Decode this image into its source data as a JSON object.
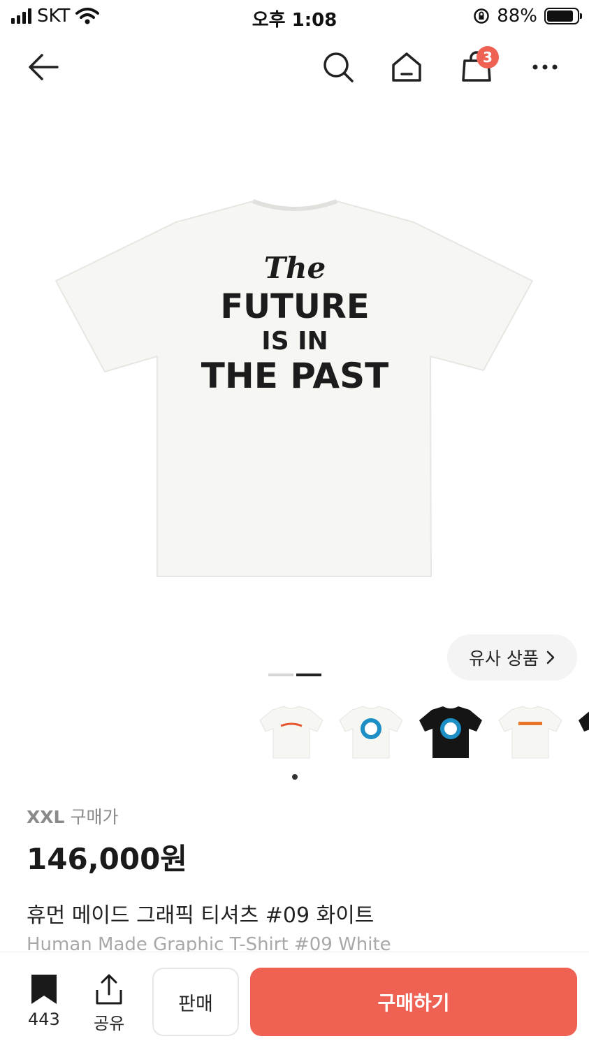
{
  "status_bar": {
    "carrier": "SKT",
    "time": "오후 1:08",
    "battery_percent": "88%",
    "battery_level": 0.88
  },
  "nav": {
    "cart_count": "3"
  },
  "product": {
    "image_text": [
      "The",
      "FUTURE",
      "IS IN",
      "THE PAST"
    ],
    "similar_label": "유사 상품",
    "image_pager": {
      "count": 2,
      "active_index": 1
    },
    "thumbnails": [
      {
        "color": "white",
        "print": "Human Made"
      },
      {
        "color": "white",
        "print": "duck-logo"
      },
      {
        "color": "black",
        "print": "duck-logo"
      },
      {
        "color": "white",
        "print": "DRY ALLS"
      },
      {
        "color": "black",
        "print": ""
      }
    ],
    "size": "XXL",
    "price_label": "구매가",
    "price": "146,000원",
    "title_ko": "휴먼 메이드 그래픽 티셔츠 #09 화이트",
    "title_en": "Human Made Graphic T-Shirt #09 White"
  },
  "bottom_bar": {
    "bookmark_count": "443",
    "share_label": "공유",
    "sell_label": "판매",
    "buy_label": "구매하기"
  },
  "colors": {
    "accent": "#ef6253",
    "text": "#222222",
    "muted": "#8a8a8a"
  }
}
